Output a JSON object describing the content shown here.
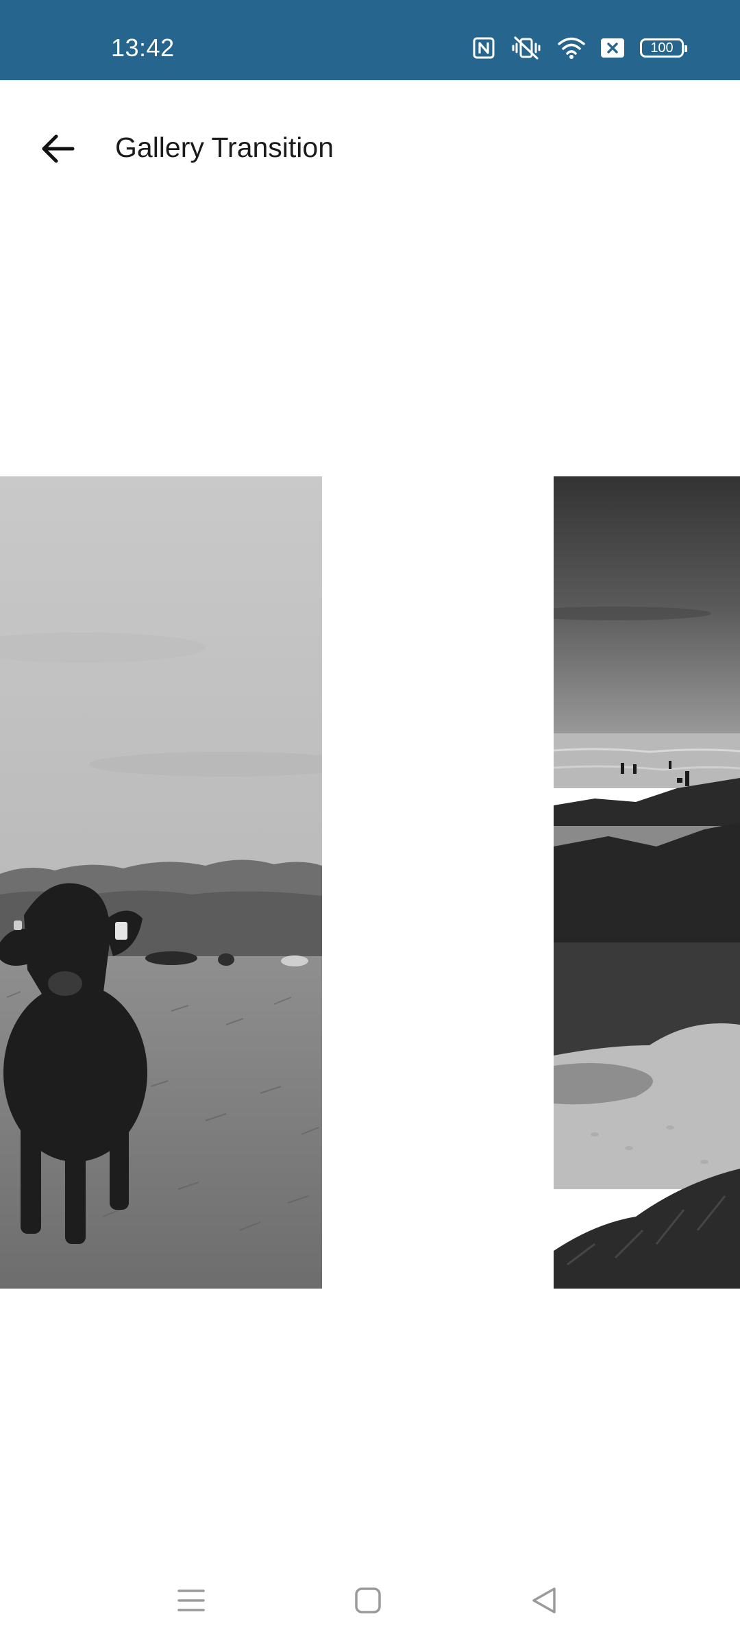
{
  "status_bar": {
    "time": "13:42",
    "battery_level": "100",
    "background_color": "#26658d",
    "icons": [
      "nfc-icon",
      "vibrate-off-icon",
      "wifi-icon",
      "sim-off-icon",
      "battery-icon"
    ]
  },
  "app_bar": {
    "title": "Gallery Transition",
    "back_icon": "arrow-back-icon"
  },
  "gallery": {
    "items": [
      {
        "name": "cow-photo",
        "style": "grayscale"
      },
      {
        "name": "beach-photo",
        "style": "grayscale"
      }
    ]
  },
  "nav_bar": {
    "buttons": [
      "menu-icon",
      "home-icon",
      "back-triangle-icon"
    ]
  }
}
